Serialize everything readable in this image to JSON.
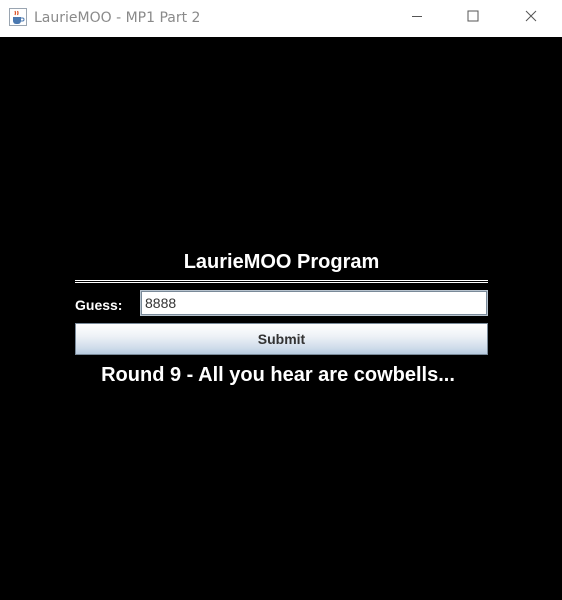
{
  "window": {
    "title": "LaurieMOO - MP1 Part 2",
    "app_icon": "java-coffee-cup-icon",
    "controls": {
      "minimize_icon": "minimize-icon",
      "maximize_icon": "maximize-icon",
      "close_icon": "close-icon"
    }
  },
  "main": {
    "heading": "LaurieMOO Program",
    "guess_label": "Guess:",
    "guess_value": "8888",
    "submit_label": "Submit",
    "status": "Round 9 - All you hear are cowbells..."
  },
  "colors": {
    "background": "#000000",
    "text": "#ffffff",
    "titlebar": "#ffffff",
    "title_text": "#8a8a8a"
  }
}
